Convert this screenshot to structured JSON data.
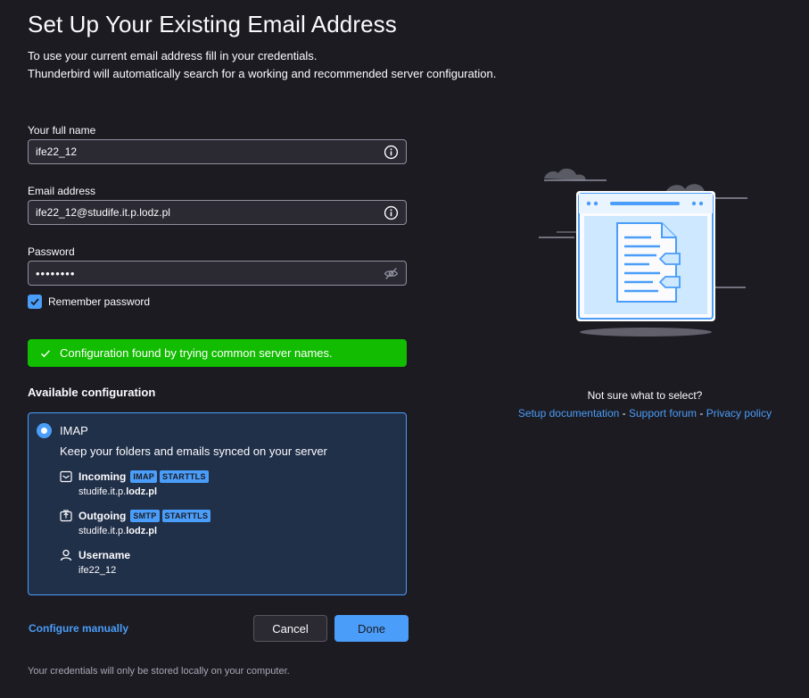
{
  "header": {
    "title": "Set Up Your Existing Email Address",
    "intro_line1": "To use your current email address fill in your credentials.",
    "intro_line2": "Thunderbird will automatically search for a working and recommended server configuration."
  },
  "form": {
    "full_name_label": "Your full name",
    "full_name_value": "ife22_12",
    "email_label": "Email address",
    "email_value": "ife22_12@studife.it.p.lodz.pl",
    "password_label": "Password",
    "password_value": "••••••••",
    "remember_label": "Remember password",
    "remember_checked": true
  },
  "status": {
    "message": "Configuration found by trying common server names."
  },
  "config": {
    "section_title": "Available configuration",
    "protocol": "IMAP",
    "description": "Keep your folders and emails synced on your server",
    "incoming": {
      "label": "Incoming",
      "tags": [
        "IMAP",
        "STARTTLS"
      ],
      "host_prefix": "studife.it.p.",
      "host_domain": "lodz.pl"
    },
    "outgoing": {
      "label": "Outgoing",
      "tags": [
        "SMTP",
        "STARTTLS"
      ],
      "host_prefix": "studife.it.p.",
      "host_domain": "lodz.pl"
    },
    "username": {
      "label": "Username",
      "value": "ife22_12"
    }
  },
  "actions": {
    "configure_manually": "Configure manually",
    "cancel": "Cancel",
    "done": "Done"
  },
  "help": {
    "question": "Not sure what to select?",
    "setup_doc": "Setup documentation",
    "separator": " - ",
    "support_forum": "Support forum",
    "privacy_policy": "Privacy policy"
  },
  "footer": {
    "note": "Your credentials will only be stored locally on your computer."
  },
  "colors": {
    "background": "#1c1b22",
    "accent": "#4a9df8",
    "success": "#12bc00",
    "card": "#213049"
  }
}
